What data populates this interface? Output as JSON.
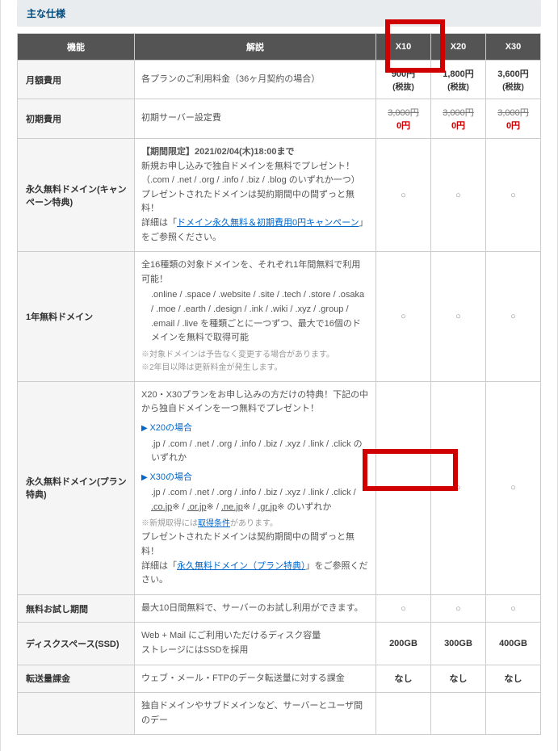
{
  "title": "主な仕様",
  "headers": {
    "feature": "機能",
    "desc": "解説",
    "plans": [
      "X10",
      "X20",
      "X30"
    ]
  },
  "rows": {
    "monthly": {
      "label": "月額費用",
      "desc": "各プランのご利用料金（36ヶ月契約の場合）",
      "prices": [
        {
          "val": "900円",
          "tax": "(税抜)"
        },
        {
          "val": "1,800円",
          "tax": "(税抜)"
        },
        {
          "val": "3,600円",
          "tax": "(税抜)"
        }
      ]
    },
    "initial": {
      "label": "初期費用",
      "desc": "初期サーバー設定費",
      "prices": [
        {
          "orig": "3,000円",
          "now": "0円"
        },
        {
          "orig": "3,000円",
          "now": "0円"
        },
        {
          "orig": "3,000円",
          "now": "0円"
        }
      ]
    },
    "freeDomainCampaign": {
      "label": "永久無料ドメイン(キャンペーン特典)",
      "limited": "【期間限定】2021/02/04(木)18:00まで",
      "line1": "新規お申し込みで独自ドメインを無料でプレゼント！",
      "tlds": "（.com / .net / .org / .info / .biz / .blog のいずれか一つ）",
      "line2": "プレゼントされたドメインは契約期間中の間ずっと無料！",
      "line3a": "詳細は「",
      "linkA": "ドメイン永久無料＆初期費用0円キャンペーン",
      "line3b": "」をご参照ください。",
      "marks": [
        "○",
        "○",
        "○"
      ]
    },
    "oneYearDomain": {
      "label": "1年無料ドメイン",
      "line1": "全16種類の対象ドメインを、それぞれ1年間無料で利用可能！",
      "tlds": ".online / .space / .website / .site / .tech / .store / .osaka / .moe / .earth / .design / .ink / .wiki / .xyz / .group / .email / .live を種類ごとに一つずつ、最大で16個のドメインを無料で取得可能",
      "note1": "対象ドメインは予告なく変更する場合があります。",
      "note2": "2年目以降は更新料金が発生します。",
      "marks": [
        "○",
        "○",
        "○"
      ]
    },
    "freeDomainPlan": {
      "label": "永久無料ドメイン(プラン特典)",
      "intro": "X20・X30プランをお申し込みの方だけの特典！下記の中から独自ドメインを一つ無料でプレゼント！",
      "x20label": "X20の場合",
      "x20tlds": ".jp / .com / .net / .org / .info / .biz / .xyz / .link / .click のいずれか",
      "x30label": "X30の場合",
      "x30tlds_a": ".jp / .com / .net / .org / .info / .biz / .xyz / .link / .click / ",
      "x30cojp": ".co.jp",
      "x30sep": "※ / ",
      "x30orjp": ".or.jp",
      "x30nejp": ".ne.jp",
      "x30grjp": ".gr.jp",
      "x30tlds_b": "※ のいずれか",
      "noteA_pre": "新規取得には",
      "noteA_link": "取得条件",
      "noteA_post": "があります。",
      "line4": "プレゼントされたドメインは契約期間中の間ずっと無料！",
      "line5a": "詳細は「",
      "linkB": "永久無料ドメイン（プラン特典）",
      "line5b": "」をご参照ください。",
      "marks": [
        "-",
        "○",
        "○"
      ]
    },
    "trial": {
      "label": "無料お試し期間",
      "desc": "最大10日間無料で、サーバーのお試し利用ができます。",
      "marks": [
        "○",
        "○",
        "○"
      ]
    },
    "disk": {
      "label": "ディスクスペース(SSD)",
      "desc1": "Web + Mail にご利用いただけるディスク容量",
      "desc2": "ストレージにはSSDを採用",
      "vals": [
        "200GB",
        "300GB",
        "400GB"
      ]
    },
    "transfer": {
      "label": "転送量課金",
      "desc": "ウェブ・メール・FTPのデータ転送量に対する課金",
      "vals": [
        "なし",
        "なし",
        "なし"
      ]
    },
    "partial": {
      "label1": "",
      "desc1": "独自ドメインやサブドメインなど、サーバーとユーザ間のデー"
    }
  }
}
